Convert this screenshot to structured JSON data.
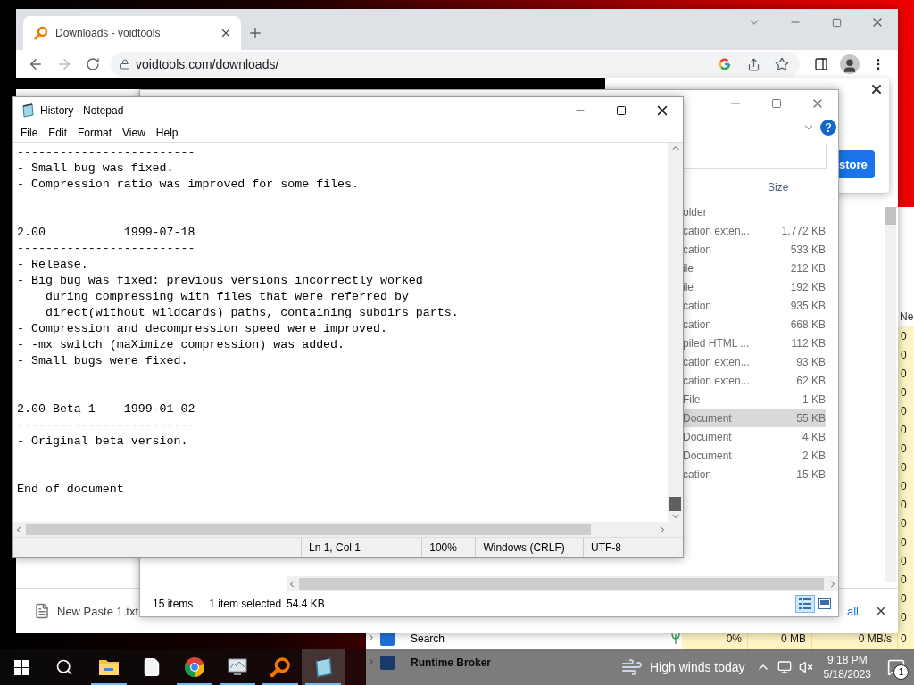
{
  "task_manager": {
    "net_header": "Ne",
    "rows": [
      {
        "network": "0"
      },
      {
        "network": "0"
      },
      {
        "network": "0"
      },
      {
        "network": "0"
      },
      {
        "network": "0"
      },
      {
        "network": "0"
      },
      {
        "network": "0"
      },
      {
        "network": "0"
      },
      {
        "network": "0"
      },
      {
        "network": "0"
      },
      {
        "network": "0"
      },
      {
        "network": "0"
      },
      {
        "network": "0"
      },
      {
        "network": "0"
      },
      {
        "network": "0"
      },
      {
        "network": "0"
      },
      {
        "name": "Search",
        "efficiency_mode": true,
        "cpu": "0%",
        "memory": "0 MB",
        "disk": "0 MB/s",
        "network": "0"
      },
      {
        "name": "Runtime Broker"
      }
    ]
  },
  "browser": {
    "tabs": [
      {
        "title": "Downloads - voidtools",
        "selected": true
      }
    ],
    "url": "voidtools.com/downloads/",
    "popup": {
      "button": "store"
    },
    "download_bar": {
      "file": "New Paste 1.txt",
      "link": "all"
    }
  },
  "explorer": {
    "columns": [
      {
        "label": "Size"
      }
    ],
    "rows": [
      {
        "type": "older",
        "size": "",
        "selected": false
      },
      {
        "type": "cation exten...",
        "size": "1,772 KB",
        "selected": false
      },
      {
        "type": "cation",
        "size": "533 KB",
        "selected": false
      },
      {
        "type": "ile",
        "size": "212 KB",
        "selected": false
      },
      {
        "type": "ile",
        "size": "192 KB",
        "selected": false
      },
      {
        "type": "cation",
        "size": "935 KB",
        "selected": false
      },
      {
        "type": "cation",
        "size": "668 KB",
        "selected": false
      },
      {
        "type": "piled HTML ...",
        "size": "112 KB",
        "selected": false
      },
      {
        "type": "cation exten...",
        "size": "93 KB",
        "selected": false
      },
      {
        "type": "cation exten...",
        "size": "62 KB",
        "selected": false
      },
      {
        "type": "File",
        "size": "1 KB",
        "selected": false
      },
      {
        "type": "Document",
        "size": "55 KB",
        "selected": true
      },
      {
        "type": "Document",
        "size": "4 KB",
        "selected": false
      },
      {
        "type": "Document",
        "size": "2 KB",
        "selected": false
      },
      {
        "type": "cation",
        "size": "15 KB",
        "selected": false
      }
    ],
    "status": {
      "count": "15 items",
      "selection": "1 item selected",
      "size": "54.4 KB"
    },
    "views": [
      {
        "kind": "details",
        "selected": true
      },
      {
        "kind": "preview",
        "selected": false
      }
    ]
  },
  "notepad": {
    "title": "History - Notepad",
    "menu": [
      "File",
      "Edit",
      "Format",
      "View",
      "Help"
    ],
    "text": "-------------------------\n- Small bug was fixed.\n- Compression ratio was improved for some files.\n\n\n2.00           1999-07-18\n-------------------------\n- Release.\n- Big bug was fixed: previous versions incorrectly worked\n    during compressing with files that were referred by\n    direct(without wildcards) paths, containing subdirs parts.\n- Compression and decompression speed were improved.\n- -mx switch (maXimize compression) was added.\n- Small bugs were fixed.\n\n\n2.00 Beta 1    1999-01-02\n-------------------------\n- Original beta version.\n\n\nEnd of document",
    "status": [
      "Ln 1, Col 1",
      "100%",
      "Windows (CRLF)",
      "UTF-8"
    ]
  },
  "taskbar": {
    "apps": [
      {
        "kind": "folder",
        "running": true,
        "active": false
      },
      {
        "kind": "file",
        "running": false,
        "active": false
      },
      {
        "kind": "chrome",
        "running": true,
        "active": false
      },
      {
        "kind": "monitor",
        "running": true,
        "active": false
      },
      {
        "kind": "magnifier",
        "running": true,
        "active": false
      },
      {
        "kind": "notepad",
        "running": true,
        "active": true
      }
    ],
    "weather": "High winds today",
    "time": "9:18 PM",
    "date": "5/18/2023",
    "notifications": "1"
  }
}
